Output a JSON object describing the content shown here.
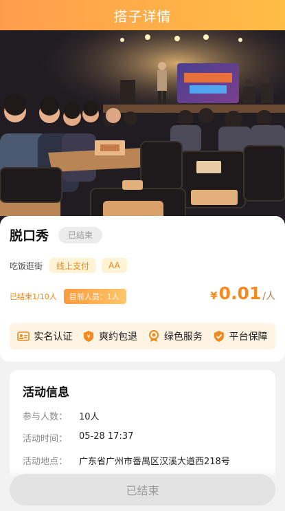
{
  "header": {
    "title": "搭子详情"
  },
  "activity": {
    "title": "脱口秀",
    "status": "已结束",
    "category": "吃饭逛街",
    "tags": [
      "线上支付",
      "AA"
    ],
    "people_status": "已结束1/10人",
    "current_people_label": "目前人员：",
    "current_people_value": "1人",
    "price_currency": "¥",
    "price_amount": "0.01",
    "price_unit": "/人"
  },
  "guarantees": [
    {
      "icon": "id-card-icon",
      "label": "实名认证"
    },
    {
      "icon": "shield-icon",
      "label": "爽约包退"
    },
    {
      "icon": "badge-icon",
      "label": "绿色服务"
    },
    {
      "icon": "shield-check-icon",
      "label": "平台保障"
    }
  ],
  "info": {
    "heading": "活动信息",
    "participants_key": "参与人数：",
    "participants_value": "10人",
    "time_key": "活动时间：",
    "time_value": "05-28 17:37",
    "location_key": "活动地点：",
    "location_value": "广东省广州市番禺区汉溪大道西218号"
  },
  "footer": {
    "button_label": "已结束"
  },
  "colors": {
    "accent": "#f58a1e",
    "header_start": "#ff9d4d",
    "header_end": "#ffbd45",
    "tag_bg": "#fff3d6"
  }
}
